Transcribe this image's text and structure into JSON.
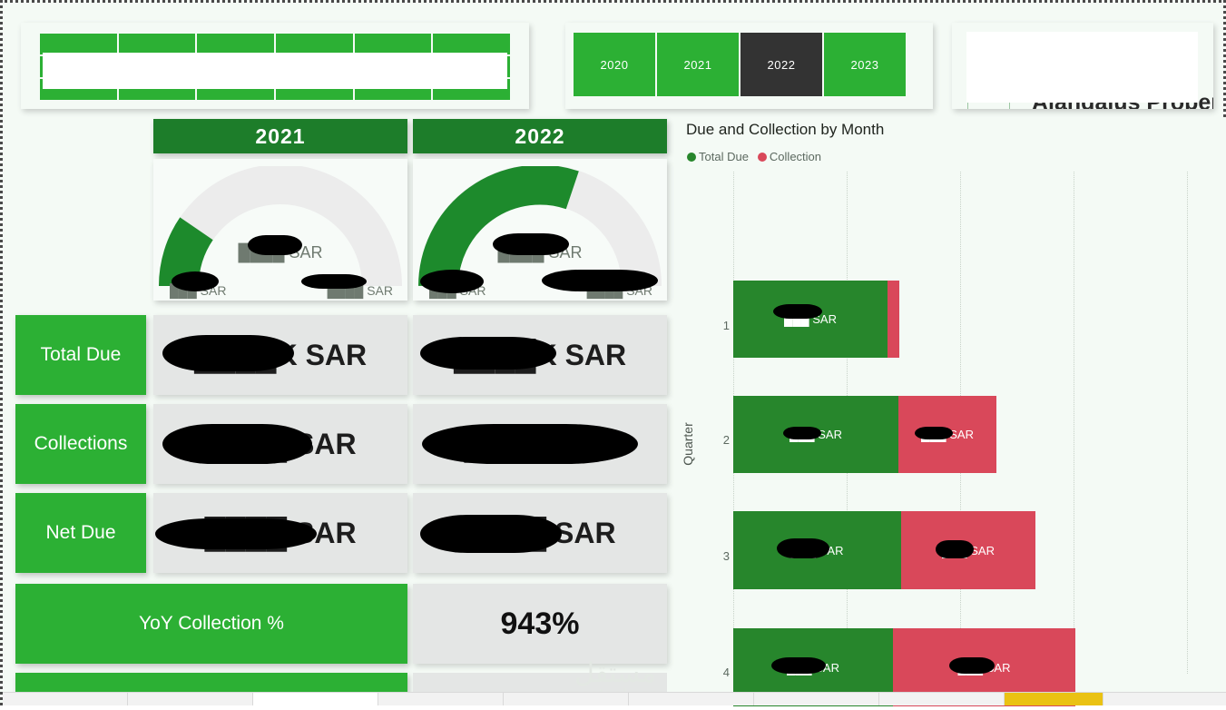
{
  "report": {
    "brand_title": "Alandalus Property"
  },
  "slicer": {
    "name": "property-slicer",
    "cells": [
      "",
      "",
      "",
      "",
      "",
      "",
      "",
      "",
      "",
      "",
      "",
      "",
      "",
      "",
      "",
      "",
      "",
      ""
    ]
  },
  "year_slicer": {
    "options": [
      "2020",
      "2021",
      "2022",
      "2023"
    ],
    "selected": "2022"
  },
  "columns": {
    "year_a": "2021",
    "year_b": "2022"
  },
  "gauges": [
    {
      "year": "2021",
      "center_value": "████ SAR",
      "min_label": "███ SAR",
      "max_label": "████ SAR",
      "percent": 11
    },
    {
      "year": "2022",
      "center_value": "████ SAR",
      "min_label": "███ SAR",
      "max_label": "████ SAR",
      "percent": 62
    }
  ],
  "metrics": [
    {
      "label": "Total Due",
      "value_2021": "████K SAR",
      "value_2022": "████K SAR"
    },
    {
      "label": "Collections",
      "value_2021": "████ SAR",
      "value_2022": "████ SAR"
    },
    {
      "label": "Net Due",
      "value_2021": "████ SAR",
      "value_2022": "████ SAR"
    }
  ],
  "yoy": {
    "label": "YoY Collection %",
    "value": "943%"
  },
  "watermark": {
    "arabic": "مستقل",
    "latin": "mostaql.com"
  },
  "colors": {
    "brand_green": "#2cb034",
    "header_green": "#1d7d2a",
    "bar_green": "#27862c",
    "bar_red": "#d9485a",
    "selected_dark": "#333333",
    "value_tile": "#e4e6e5",
    "canvas": "#f4faf5",
    "tab_accent": "#eac213"
  },
  "chart_data": {
    "type": "bar",
    "title": "Due and Collection by Month",
    "orientation": "horizontal",
    "stacked": true,
    "xlabel": "",
    "ylabel": "Quarter",
    "categories": [
      "1",
      "2",
      "3",
      "4"
    ],
    "tick_labels": [
      "1",
      "2",
      "3",
      "4"
    ],
    "grid": "vertical-dotted",
    "legend_position": "top-left",
    "series": [
      {
        "name": "Total Due",
        "color": "#27862c",
        "values": [
          170,
          182,
          185,
          176
        ],
        "data_labels": [
          "███ SAR",
          "███ SAR",
          "███ SAR",
          "███ SAR"
        ]
      },
      {
        "name": "Collection",
        "color": "#d9485a",
        "values": [
          13,
          108,
          148,
          201
        ],
        "data_labels": [
          "",
          "███ SAR",
          "███ SAR",
          "███ SAR"
        ]
      }
    ],
    "gridline_positions": [
      0,
      125,
      250,
      375,
      500
    ],
    "xlim": [
      0,
      545
    ]
  },
  "tabstrip": {
    "tabs": [
      "",
      "",
      "",
      "",
      "",
      "",
      "",
      "",
      "",
      ""
    ],
    "active_index": 2,
    "accent_index": 8
  }
}
